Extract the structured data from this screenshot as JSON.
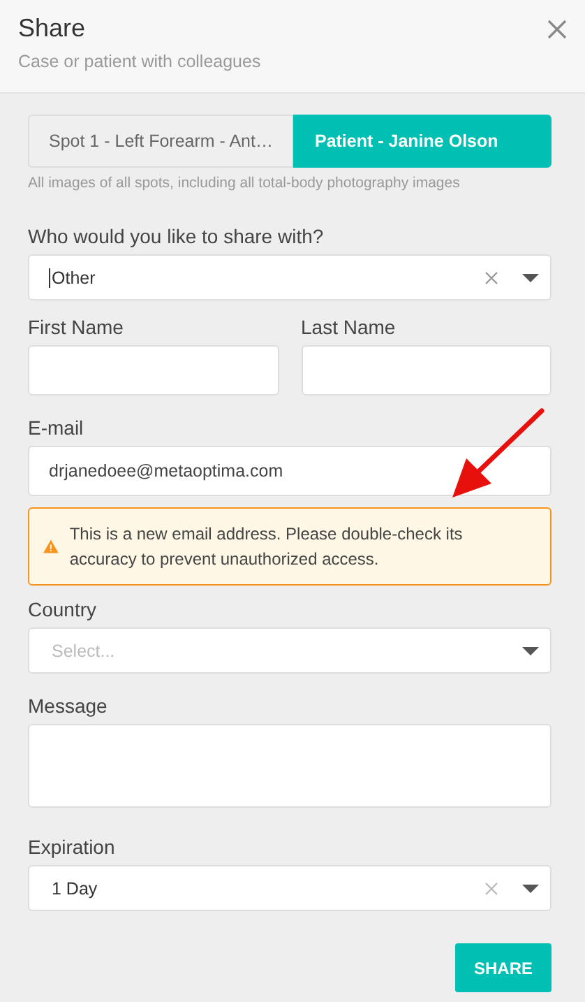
{
  "dialog": {
    "title": "Share",
    "subtitle": "Case or patient with colleagues"
  },
  "tabs": [
    {
      "label": "Spot 1 - Left Forearm - Ant…",
      "selected": false
    },
    {
      "label": "Patient - Janine Olson",
      "selected": true
    }
  ],
  "tab_hint": "All images of all spots, including all total-body photography images",
  "recipient": {
    "label": "Who would you like to share with?",
    "value": "Other",
    "clearable": true,
    "focused": true
  },
  "name_fields": [
    {
      "label": "First Name"
    },
    {
      "label": "Last Name"
    }
  ],
  "email": {
    "label": "E-mail",
    "value": "drjanedoee@metaoptima.com"
  },
  "warning": {
    "text": "This is a new email address. Please double-check its accuracy to prevent unauthorized access."
  },
  "country": {
    "label": "Country",
    "placeholder": "Select...",
    "clearable": false
  },
  "message": {
    "label": "Message"
  },
  "expiration": {
    "label": "Expiration",
    "value": "1 Day",
    "clearable": true
  },
  "share_button": "SHARE"
}
